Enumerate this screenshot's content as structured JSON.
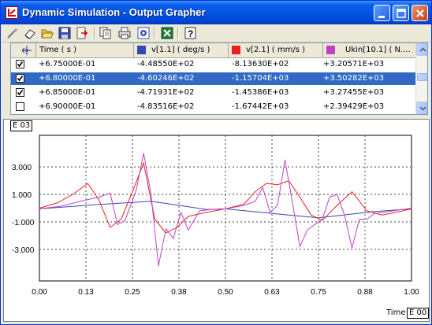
{
  "window": {
    "title": "Dynamic Simulation - Output Grapher"
  },
  "toolbar": {
    "tools": [
      "wand-icon",
      "eraser-icon",
      "open-folder-icon",
      "save-icon",
      "export-icon",
      "copy-icon",
      "print-icon",
      "settings-icon",
      "excel-icon",
      "help-icon"
    ]
  },
  "table": {
    "columns": [
      {
        "label": "Time ( s )",
        "color": ""
      },
      {
        "label": "v[1.1] ( deg/s )",
        "color": "#3548b5"
      },
      {
        "label": "v[2.1] ( mm/s )",
        "color": "#e8201e"
      },
      {
        "label": "Ukin[10.1] ( N....",
        "color": "#c040c8"
      }
    ],
    "rows": [
      {
        "checked": true,
        "selected": false,
        "time": "+6.75000E-01",
        "v1": "-4.48550E+02",
        "v2": "-8.13630E+02",
        "ukin": "+3.20571E+03"
      },
      {
        "checked": true,
        "selected": true,
        "time": "+6.80000E-01",
        "v1": "-4.60246E+02",
        "v2": "-1.15704E+03",
        "ukin": "+3.50282E+03"
      },
      {
        "checked": true,
        "selected": false,
        "time": "+6.85000E-01",
        "v1": "-4.71931E+02",
        "v2": "-1.45386E+03",
        "ukin": "+3.27455E+03"
      },
      {
        "checked": false,
        "selected": false,
        "time": "+6.90000E-01",
        "v1": "-4.83516E+02",
        "v2": "-1.67442E+03",
        "ukin": "+2.39429E+03"
      }
    ]
  },
  "chart_data": {
    "type": "line",
    "exponent_label": "E 03",
    "xlabel": "Time",
    "x_exponent_label": "E 00",
    "xlim": [
      0,
      1
    ],
    "ylim": [
      -5.3,
      5.3
    ],
    "x_ticks": [
      "0.00",
      "0.13",
      "0.25",
      "0.38",
      "0.50",
      "0.63",
      "0.75",
      "0.88",
      "1.00"
    ],
    "y_ticks": [
      {
        "value": 3,
        "label": "3.000"
      },
      {
        "value": 1,
        "label": "1.000"
      },
      {
        "value": -1,
        "label": "-1.000"
      },
      {
        "value": -3,
        "label": "-3.000"
      }
    ],
    "grid": true,
    "series": [
      {
        "name": "v[1.1] ( deg/s )",
        "color": "#3548b5",
        "x": [
          0.0,
          0.15,
          0.3,
          0.45,
          0.5,
          0.65,
          0.75,
          0.9,
          1.0
        ],
        "y": [
          -0.05,
          0.25,
          0.5,
          -0.1,
          -0.05,
          -0.45,
          -0.7,
          -0.25,
          -0.05
        ]
      },
      {
        "name": "v[2.1] ( mm/s )",
        "color": "#e8201e",
        "x": [
          0.0,
          0.05,
          0.09,
          0.13,
          0.16,
          0.19,
          0.22,
          0.25,
          0.28,
          0.31,
          0.34,
          0.37,
          0.4,
          0.45,
          0.5,
          0.55,
          0.58,
          0.61,
          0.64,
          0.67,
          0.7,
          0.73,
          0.76,
          0.8,
          0.84,
          0.88,
          0.92,
          0.96,
          1.0
        ],
        "y": [
          0.0,
          0.4,
          1.0,
          1.8,
          0.6,
          -1.4,
          -0.8,
          1.2,
          3.3,
          -0.8,
          -1.8,
          -1.4,
          -0.6,
          -0.3,
          -0.05,
          0.3,
          1.2,
          1.8,
          1.7,
          2.0,
          0.8,
          -0.5,
          -0.9,
          0.2,
          1.2,
          -0.2,
          -0.5,
          -0.3,
          -0.05
        ]
      },
      {
        "name": "Ukin[10.1] ( N.... ",
        "color": "#c040c8",
        "x": [
          0.0,
          0.06,
          0.11,
          0.16,
          0.19,
          0.21,
          0.23,
          0.26,
          0.28,
          0.3,
          0.32,
          0.34,
          0.36,
          0.38,
          0.4,
          0.43,
          0.46,
          0.5,
          0.55,
          0.58,
          0.6,
          0.62,
          0.64,
          0.66,
          0.68,
          0.7,
          0.72,
          0.74,
          0.76,
          0.78,
          0.8,
          0.82,
          0.84,
          0.86,
          0.88,
          0.9,
          0.95,
          1.0
        ],
        "y": [
          -0.05,
          0.15,
          0.5,
          0.8,
          1.1,
          -1.2,
          -0.9,
          1.3,
          4.0,
          1.0,
          -4.2,
          -1.5,
          -2.2,
          -0.3,
          -1.6,
          -0.2,
          -0.1,
          -0.05,
          0.2,
          0.5,
          1.5,
          -0.3,
          0.2,
          3.5,
          0.4,
          -2.8,
          -1.6,
          -1.2,
          -0.8,
          0.8,
          1.0,
          -0.5,
          -2.9,
          -0.8,
          -0.8,
          -0.4,
          -0.2,
          0.0
        ]
      }
    ]
  }
}
